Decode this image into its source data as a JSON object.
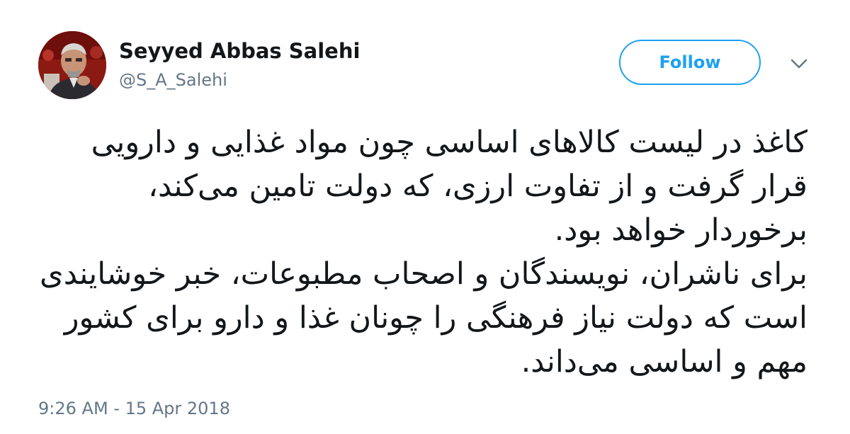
{
  "user": {
    "display_name": "Seyyed Abbas Salehi",
    "handle": "@S_A_Salehi",
    "avatar_icon": "profile-photo"
  },
  "actions": {
    "follow_label": "Follow",
    "menu_icon": "chevron-down-icon"
  },
  "tweet": {
    "paragraph_1": "کاغذ در لیست کالاهای اساسی چون مواد غذایی و دارویی قرار گرفت و از تفاوت ارزی، که دولت تامین می‌کند، برخوردار خواهد بود.",
    "paragraph_2": "برای ناشران، نویسندگان و اصحاب مطبوعات، خبر خوشایندی است که دولت نیاز فرهنگی را چونان غذا و دارو برای کشور مهم و اساسی می‌داند.",
    "timestamp": "9:26 AM - 15 Apr 2018"
  },
  "colors": {
    "accent": "#1da1f2",
    "text_primary": "#14171a",
    "text_secondary": "#657786"
  }
}
